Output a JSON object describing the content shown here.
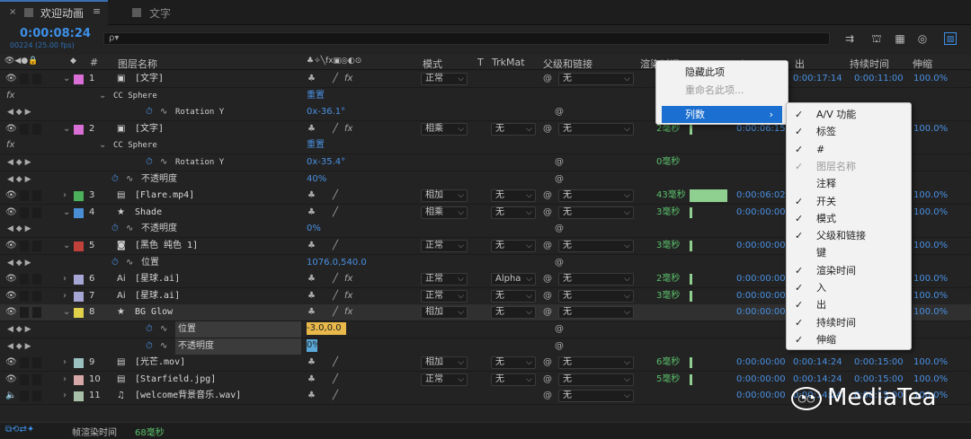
{
  "tabs": [
    {
      "label": "欢迎动画",
      "close": "×",
      "menu": "≡"
    },
    {
      "label": "文字"
    }
  ],
  "timecode": "0:00:08:24",
  "fps": "00224 (25.00 fps)",
  "search": {
    "icon": "ρ▾",
    "value": ""
  },
  "toolbar_icons": [
    "composition-flowchart-icon",
    "draft-3d-icon",
    "frame-blending-icon",
    "motion-blur-icon",
    "graph-editor-icon"
  ],
  "columns": {
    "num": "#",
    "name": "图层名称",
    "mode": "模式",
    "t": "T",
    "trkmat": "TrkMat",
    "parent": "父级和链接",
    "render": "渲染时间",
    "in": "入",
    "out": "出",
    "duration": "持续时间",
    "stretch": "伸缩"
  },
  "rows": [
    {
      "kind": "layer",
      "num": "1",
      "color": "#d96fd6",
      "icon": "comp",
      "name": "[文字]",
      "mode": "正常",
      "trkmat": "",
      "parent": "无",
      "render": "",
      "in": "",
      "out": "0:00:17:14",
      "duration": "0:00:11:00",
      "stretch": "100.0%",
      "expanded": true,
      "fx": true
    },
    {
      "kind": "effect",
      "label": "CC Sphere",
      "value": "重置"
    },
    {
      "kind": "prop",
      "label": "Rotation Y",
      "value": "0x-36.1°"
    },
    {
      "kind": "layer",
      "num": "2",
      "color": "#d96fd6",
      "icon": "comp",
      "name": "[文字]",
      "mode": "相乘",
      "trkmat": "无",
      "parent": "无",
      "render": "2毫秒",
      "in": "0:00:06:15",
      "out": "",
      "duration": "",
      "stretch": "100.0%",
      "expanded": true,
      "fx": true
    },
    {
      "kind": "effect",
      "label": "CC Sphere",
      "value": "重置"
    },
    {
      "kind": "prop",
      "label": "Rotation Y",
      "value": "0x-35.4°",
      "render": "0毫秒"
    },
    {
      "kind": "prop2",
      "label": "不透明度",
      "value": "40%"
    },
    {
      "kind": "layer",
      "num": "3",
      "color": "#4caf5a",
      "icon": "file",
      "name": "[Flare.mp4]",
      "mode": "相加",
      "trkmat": "无",
      "parent": "无",
      "render": "43毫秒",
      "in": "0:00:06:02",
      "out": "",
      "duration": "",
      "stretch": "100.0%",
      "expanded": false,
      "fx": false
    },
    {
      "kind": "layer",
      "num": "4",
      "color": "#4a8fd6",
      "icon": "star",
      "name": "Shade",
      "mode": "相乘",
      "trkmat": "无",
      "parent": "无",
      "render": "3毫秒",
      "in": "0:00:00:00",
      "out": "",
      "duration": "",
      "stretch": "100.0%",
      "expanded": true,
      "fx": false
    },
    {
      "kind": "prop2",
      "label": "不透明度",
      "value": "0%"
    },
    {
      "kind": "layer",
      "num": "5",
      "color": "#c0403a",
      "icon": "solid",
      "name": "[黑色 纯色 1]",
      "mode": "正常",
      "trkmat": "无",
      "parent": "无",
      "render": "3毫秒",
      "in": "0:00:00:00",
      "out": "",
      "duration": "",
      "stretch": "100.0%",
      "expanded": true,
      "fx": false
    },
    {
      "kind": "prop2",
      "label": "位置",
      "value": "1076.0,540.0"
    },
    {
      "kind": "layer",
      "num": "6",
      "color": "#a7a7d6",
      "icon": "ai",
      "name": "[星球.ai]",
      "mode": "正常",
      "trkmat": "Alpha",
      "parent": "无",
      "render": "2毫秒",
      "in": "0:00:00:00",
      "out": "",
      "duration": "",
      "stretch": "100.0%",
      "expanded": false,
      "fx": true
    },
    {
      "kind": "layer",
      "num": "7",
      "color": "#a7a7d6",
      "icon": "ai",
      "name": "[星球.ai]",
      "mode": "正常",
      "trkmat": "无",
      "parent": "无",
      "render": "3毫秒",
      "in": "0:00:00:00",
      "out": "",
      "duration": "",
      "stretch": "100.0%",
      "expanded": false,
      "fx": true
    },
    {
      "kind": "layer",
      "num": "8",
      "color": "#e0d04a",
      "icon": "star",
      "name": "BG Glow",
      "mode": "相加",
      "trkmat": "无",
      "parent": "无",
      "render": "",
      "in": "0:00:00:00",
      "out": "",
      "duration": "",
      "stretch": "100.0%",
      "expanded": true,
      "fx": true,
      "selected": true
    },
    {
      "kind": "prop3",
      "label": "位置",
      "value": "-3.0,0.0"
    },
    {
      "kind": "prop3",
      "label": "不透明度",
      "value": "0%"
    },
    {
      "kind": "layer",
      "num": "9",
      "color": "#9ac0c0",
      "icon": "file",
      "name": "[光芒.mov]",
      "mode": "相加",
      "trkmat": "无",
      "parent": "无",
      "render": "6毫秒",
      "in": "0:00:00:00",
      "out": "0:00:14:24",
      "duration": "0:00:15:00",
      "stretch": "100.0%",
      "expanded": false,
      "fx": false
    },
    {
      "kind": "layer",
      "num": "10",
      "color": "#d6a7a7",
      "icon": "file",
      "name": "[Starfield.jpg]",
      "mode": "正常",
      "trkmat": "无",
      "parent": "无",
      "render": "5毫秒",
      "in": "0:00:00:00",
      "out": "0:00:14:24",
      "duration": "0:00:15:00",
      "stretch": "100.0%",
      "expanded": false,
      "fx": false
    },
    {
      "kind": "layer",
      "num": "11",
      "color": "#a7c0a7",
      "icon": "audio",
      "name": "[welcome背景音乐.wav]",
      "mode": "",
      "trkmat": "",
      "parent": "无",
      "render": "",
      "in": "0:00:00:00",
      "out": "0:00:14:24",
      "duration": "0:00:15:00",
      "stretch": "100.0%",
      "expanded": false,
      "fx": false,
      "audio": true
    }
  ],
  "context_menu": {
    "items": [
      {
        "label": "隐藏此项",
        "disabled": false
      },
      {
        "label": "重命名此项...",
        "disabled": true
      },
      {
        "label": "列数",
        "highlight": true,
        "arrow": "›"
      }
    ]
  },
  "submenu": {
    "items": [
      {
        "label": "A/V 功能",
        "checked": true
      },
      {
        "label": "标签",
        "checked": true
      },
      {
        "label": "#",
        "checked": true
      },
      {
        "label": "图层名称",
        "checked": true,
        "disabled": true
      },
      {
        "label": "注释",
        "checked": false
      },
      {
        "label": "开关",
        "checked": true
      },
      {
        "label": "模式",
        "checked": true
      },
      {
        "label": "父级和链接",
        "checked": true
      },
      {
        "label": "键",
        "checked": false
      },
      {
        "label": "渲染时间",
        "checked": true
      },
      {
        "label": "入",
        "checked": true
      },
      {
        "label": "出",
        "checked": true
      },
      {
        "label": "持续时间",
        "checked": true
      },
      {
        "label": "伸缩",
        "checked": true
      }
    ]
  },
  "footer": {
    "label": "帧渲染时间",
    "value": "68毫秒"
  },
  "watermark": "MediaTea",
  "colors": {
    "accent": "#3d8fe6",
    "menu_highlight": "#1b6fd0",
    "bar": "#8fcf8f"
  }
}
